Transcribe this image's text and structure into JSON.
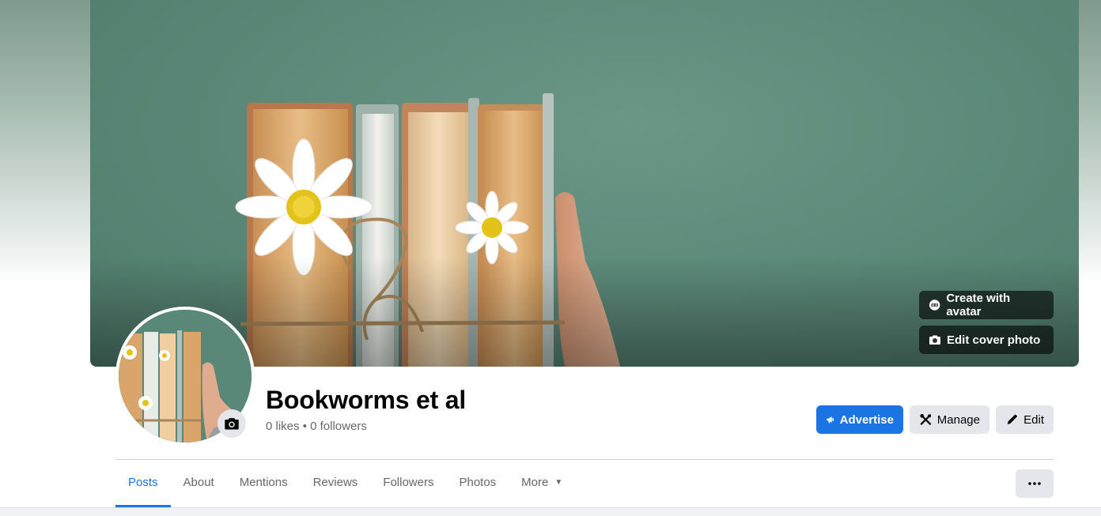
{
  "cover": {
    "create_avatar_label": "Create with avatar",
    "edit_cover_label": "Edit cover photo"
  },
  "profile": {
    "name": "Bookworms et al",
    "likes": "0 likes",
    "separator": " • ",
    "followers": "0 followers"
  },
  "actions": {
    "advertise_label": "Advertise",
    "manage_label": "Manage",
    "edit_label": "Edit"
  },
  "tabs": [
    {
      "label": "Posts",
      "active": true
    },
    {
      "label": "About",
      "active": false
    },
    {
      "label": "Mentions",
      "active": false
    },
    {
      "label": "Reviews",
      "active": false
    },
    {
      "label": "Followers",
      "active": false
    },
    {
      "label": "Photos",
      "active": false
    },
    {
      "label": "More",
      "active": false
    }
  ],
  "colors": {
    "accent": "#1b74e4",
    "cover_bg": "#5d8a7a"
  },
  "icons": {
    "avatar": "avatar-icon",
    "camera": "camera-icon",
    "advertise": "megaphone-icon",
    "manage": "tools-icon",
    "edit": "pencil-icon",
    "more": "ellipsis-icon"
  }
}
